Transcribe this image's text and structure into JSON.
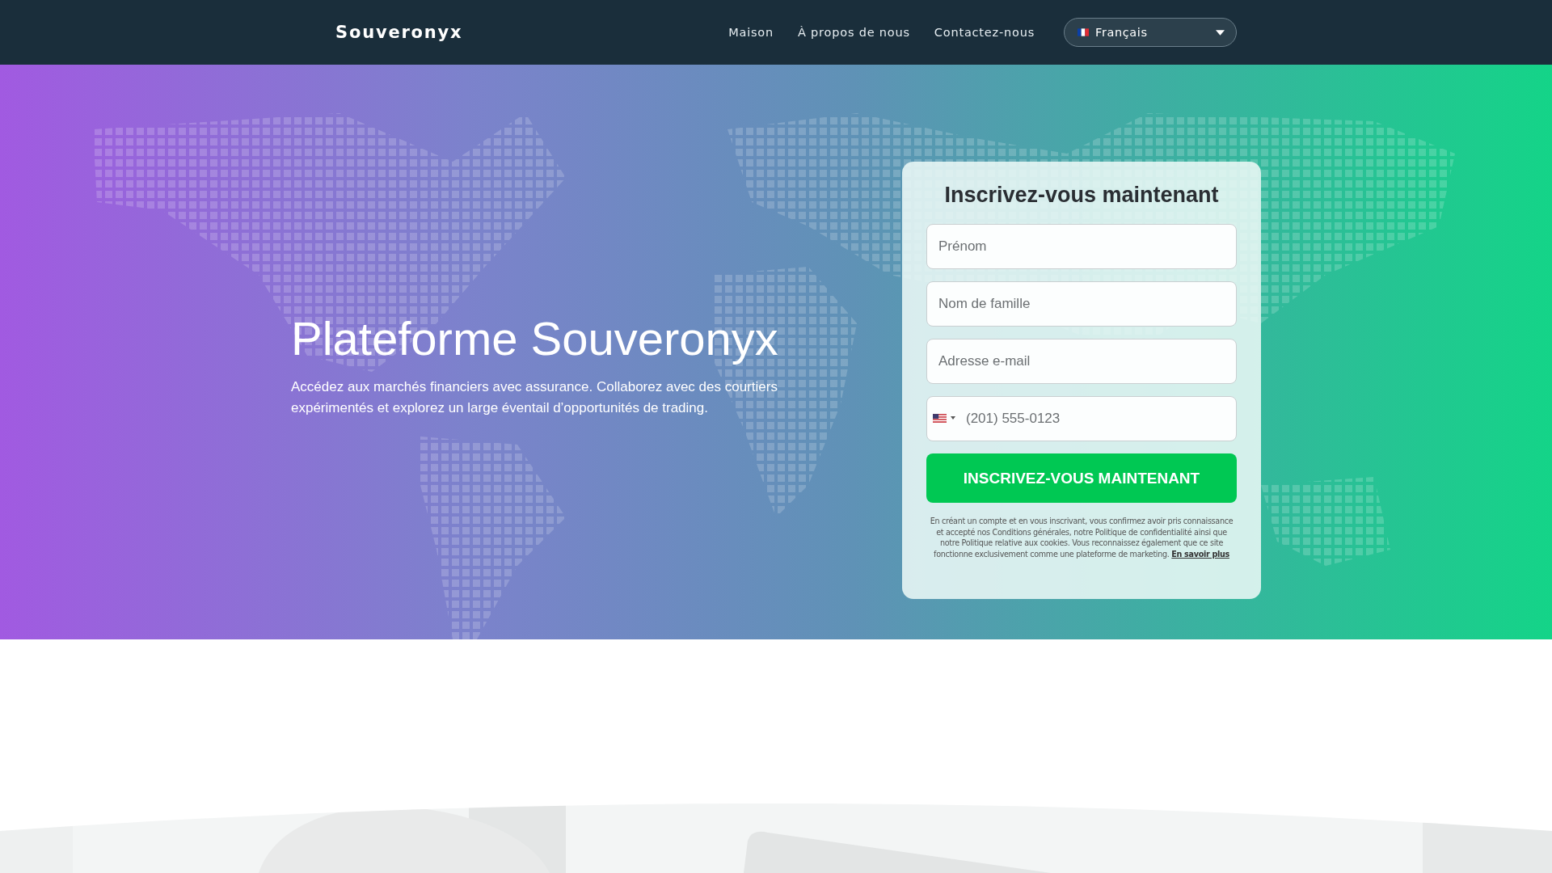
{
  "brand": "Souveronyx",
  "nav_links": [
    {
      "label": "Maison"
    },
    {
      "label": "À propos de nous"
    },
    {
      "label": "Contactez-nous"
    }
  ],
  "language_select": {
    "value": "Français"
  },
  "hero": {
    "title": "Plateforme Souveronyx",
    "text": "Accédez aux marchés financiers avec assurance. Collaborez avec des courtiers expérimentés et explorez un large éventail d’opportunités de trading."
  },
  "form": {
    "title": "Inscrivez-vous maintenant",
    "fields": [
      {
        "placeholder": "Prénom"
      },
      {
        "placeholder": "Nom de famille"
      },
      {
        "placeholder": "Adresse e-mail"
      }
    ],
    "phone": {
      "placeholder": "(201) 555-0123"
    },
    "submit": "INSCRIVEZ-VOUS MAINTENANT",
    "disclaimer": "En créant un compte et en vous inscrivant, vous confirmez avoir pris connaissance et accepté nos Conditions générales, notre Politique de confidentialité ainsi que notre Politique relative aux cookies. Vous reconnaissez également que ce site fonctionne exclusivement comme une plateforme de marketing.",
    "disclaimer_link": "En savoir plus"
  }
}
